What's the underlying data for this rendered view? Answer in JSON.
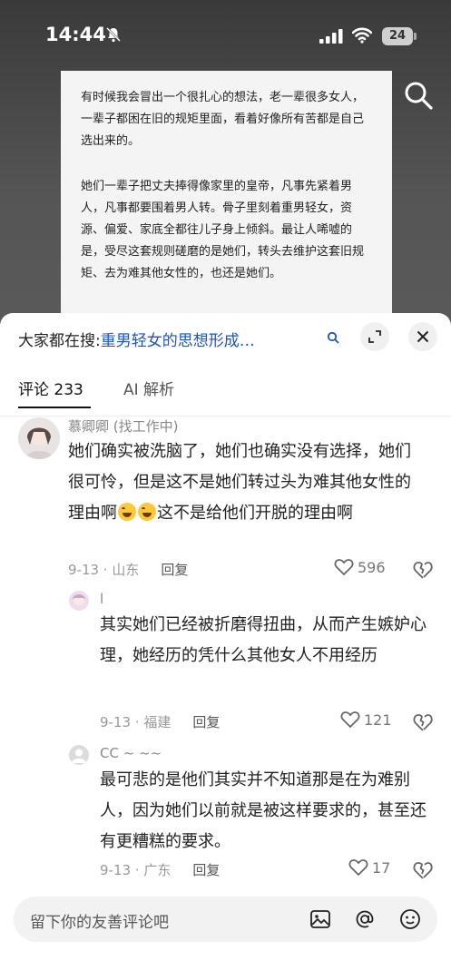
{
  "status": {
    "time": "14:44",
    "battery": "24"
  },
  "article": {
    "paragraphs": [
      "有时候我会冒出一个很扎心的想法，老一辈很多女人，一辈子都困在旧的规矩里面，看着好像所有苦都是自己选出来的。",
      "她们一辈子把丈夫捧得像家里的皇帝，凡事先紧着男人，凡事都要围着男人转。骨子里刻着重男轻女，资源、偏爱、家底全都往儿子身上倾斜。最让人唏嘘的是，受尽这套规则磋磨的是她们，转头去维护这套旧规矩、去为难其他女性的，也还是她们。"
    ]
  },
  "sheet": {
    "search_prefix": "大家都在搜:",
    "search_query": "重男轻女的思想形成…",
    "tabs": {
      "comments": "评论 233",
      "ai": "AI 解析"
    }
  },
  "comments": [
    {
      "user": "慕卿卿 (找工作中)",
      "text_a": "她们确实被洗脑了，她们也确实没有选择，她们很可怜，但是这不是她们转过头为难其他女性的理由啊",
      "text_b": "这不是给他们开脱的理由啊",
      "date": "9-13 · 山东",
      "reply": "回复",
      "likes": "596"
    },
    {
      "user": "l",
      "text": "其实她们已经被折磨得扭曲，从而产生嫉妒心理，她经历的凭什么其他女人不用经历",
      "date": "9-13 · 福建",
      "reply": "回复",
      "likes": "121"
    },
    {
      "user": "CC ~ ~~",
      "text": "最可悲的是他们其实并不知道那是在为难别人，因为她们以前就是被这样要求的，甚至还有更糟糕的要求。",
      "date": "9-13 · 广东",
      "reply": "回复",
      "likes": "17"
    }
  ],
  "input": {
    "placeholder": "留下你的友善评论吧"
  }
}
